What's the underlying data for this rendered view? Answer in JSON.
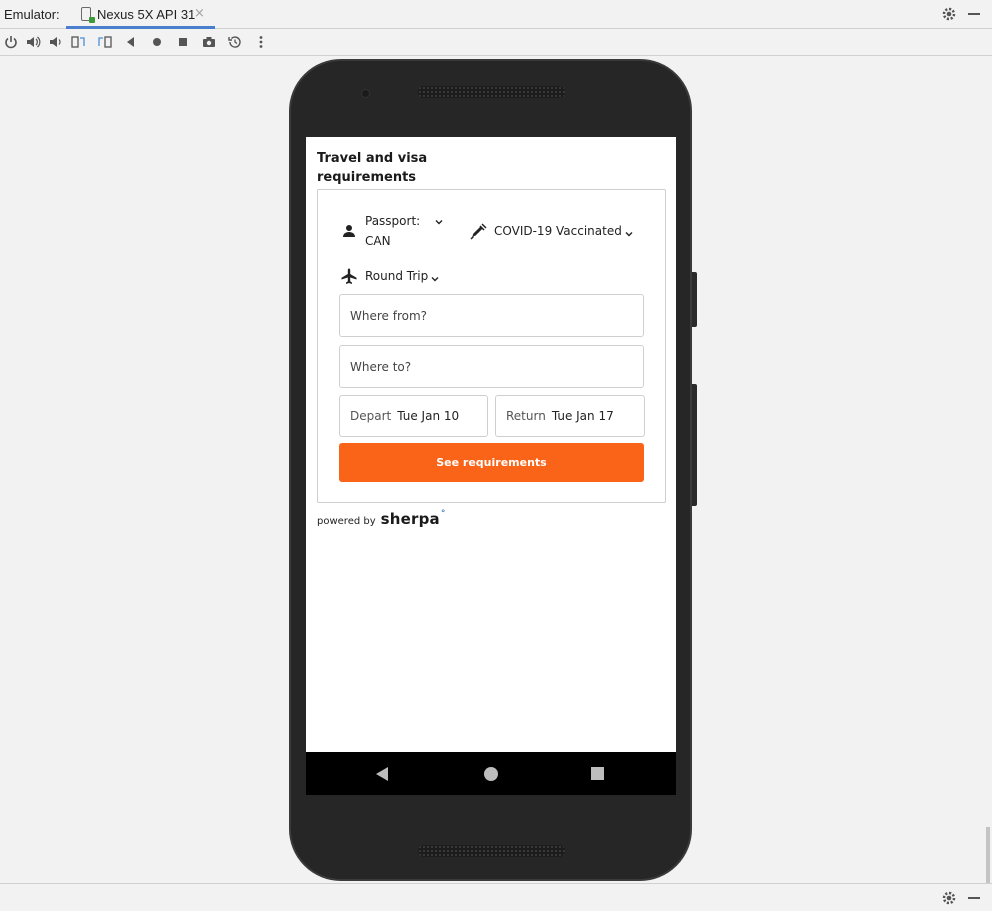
{
  "ide": {
    "label": "Emulator:",
    "tab_title": "Nexus 5X API 31",
    "tab_close": "×"
  },
  "toolbar": {
    "buttons": [
      "power-icon",
      "volume-up-icon",
      "volume-down-icon",
      "rotate-left-icon",
      "rotate-right-icon",
      "back-icon",
      "home-icon",
      "overview-icon",
      "screenshot-icon",
      "snapshot-icon",
      "more-icon"
    ]
  },
  "app": {
    "title": "Travel and visa requirements",
    "passport_label": "Passport:",
    "passport_value": "CAN",
    "vaccination": "COVID-19 Vaccinated",
    "trip_type": "Round Trip",
    "from_placeholder": "Where from?",
    "to_placeholder": "Where to?",
    "depart_label": "Depart",
    "depart_value": "Tue Jan 10",
    "return_label": "Return",
    "return_value": "Tue Jan 17",
    "cta_label": "See requirements",
    "powered_by": "powered by",
    "brand": "sherpa",
    "brand_mark": "°",
    "accent_color": "#f96418"
  }
}
